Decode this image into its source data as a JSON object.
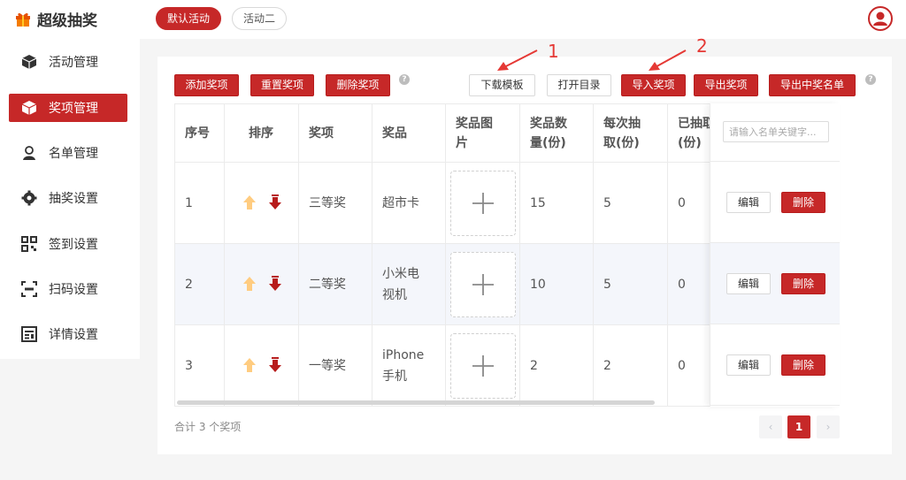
{
  "app": {
    "name": "超级抽奖"
  },
  "tabs": [
    {
      "label": "默认活动",
      "active": true
    },
    {
      "label": "活动二",
      "active": false
    }
  ],
  "sidebar": {
    "items": [
      {
        "label": "活动管理",
        "icon": "box-icon"
      },
      {
        "label": "奖项管理",
        "icon": "box-icon",
        "active": true
      },
      {
        "label": "名单管理",
        "icon": "user-icon"
      },
      {
        "label": "抽奖设置",
        "icon": "gear-icon"
      },
      {
        "label": "签到设置",
        "icon": "qrcode-icon"
      },
      {
        "label": "扫码设置",
        "icon": "scan-icon"
      },
      {
        "label": "详情设置",
        "icon": "detail-icon"
      }
    ]
  },
  "toolbar": {
    "add": "添加奖项",
    "reset": "重置奖项",
    "delete": "删除奖项",
    "download_template": "下载模板",
    "open_dir": "打开目录",
    "import": "导入奖项",
    "export": "导出奖项",
    "export_winners": "导出中奖名单",
    "help": "?"
  },
  "table": {
    "headers": {
      "index": "序号",
      "sort": "排序",
      "prize_level": "奖项",
      "prize": "奖品",
      "image_1": "奖品图",
      "image_2": "片",
      "qty_1": "奖品数",
      "qty_2": "量(份)",
      "per_draw_1": "每次抽",
      "per_draw_2": "取(份)",
      "drawn_1": "已抽取",
      "drawn_2": "(份)"
    },
    "search_placeholder": "请输入名单关键字...",
    "rows": [
      {
        "index": "1",
        "level": "三等奖",
        "prize_1": "超市卡",
        "prize_2": "",
        "qty": "15",
        "per_draw": "5",
        "drawn": "0"
      },
      {
        "index": "2",
        "level": "二等奖",
        "prize_1": "小米电",
        "prize_2": "视机",
        "qty": "10",
        "per_draw": "5",
        "drawn": "0"
      },
      {
        "index": "3",
        "level": "一等奖",
        "prize_1": "iPhone",
        "prize_2": "手机",
        "qty": "2",
        "per_draw": "2",
        "drawn": "0"
      }
    ],
    "edit_label": "编辑",
    "delete_label": "删除"
  },
  "footer": {
    "total": "合计 3 个奖项",
    "prev": "‹",
    "current_page": "1",
    "next": "›"
  },
  "annotations": {
    "one": "1",
    "two": "2"
  },
  "colors": {
    "accent": "#c62828",
    "arrow_up": "#ffcc80",
    "arrow_down": "#b71c1c"
  }
}
